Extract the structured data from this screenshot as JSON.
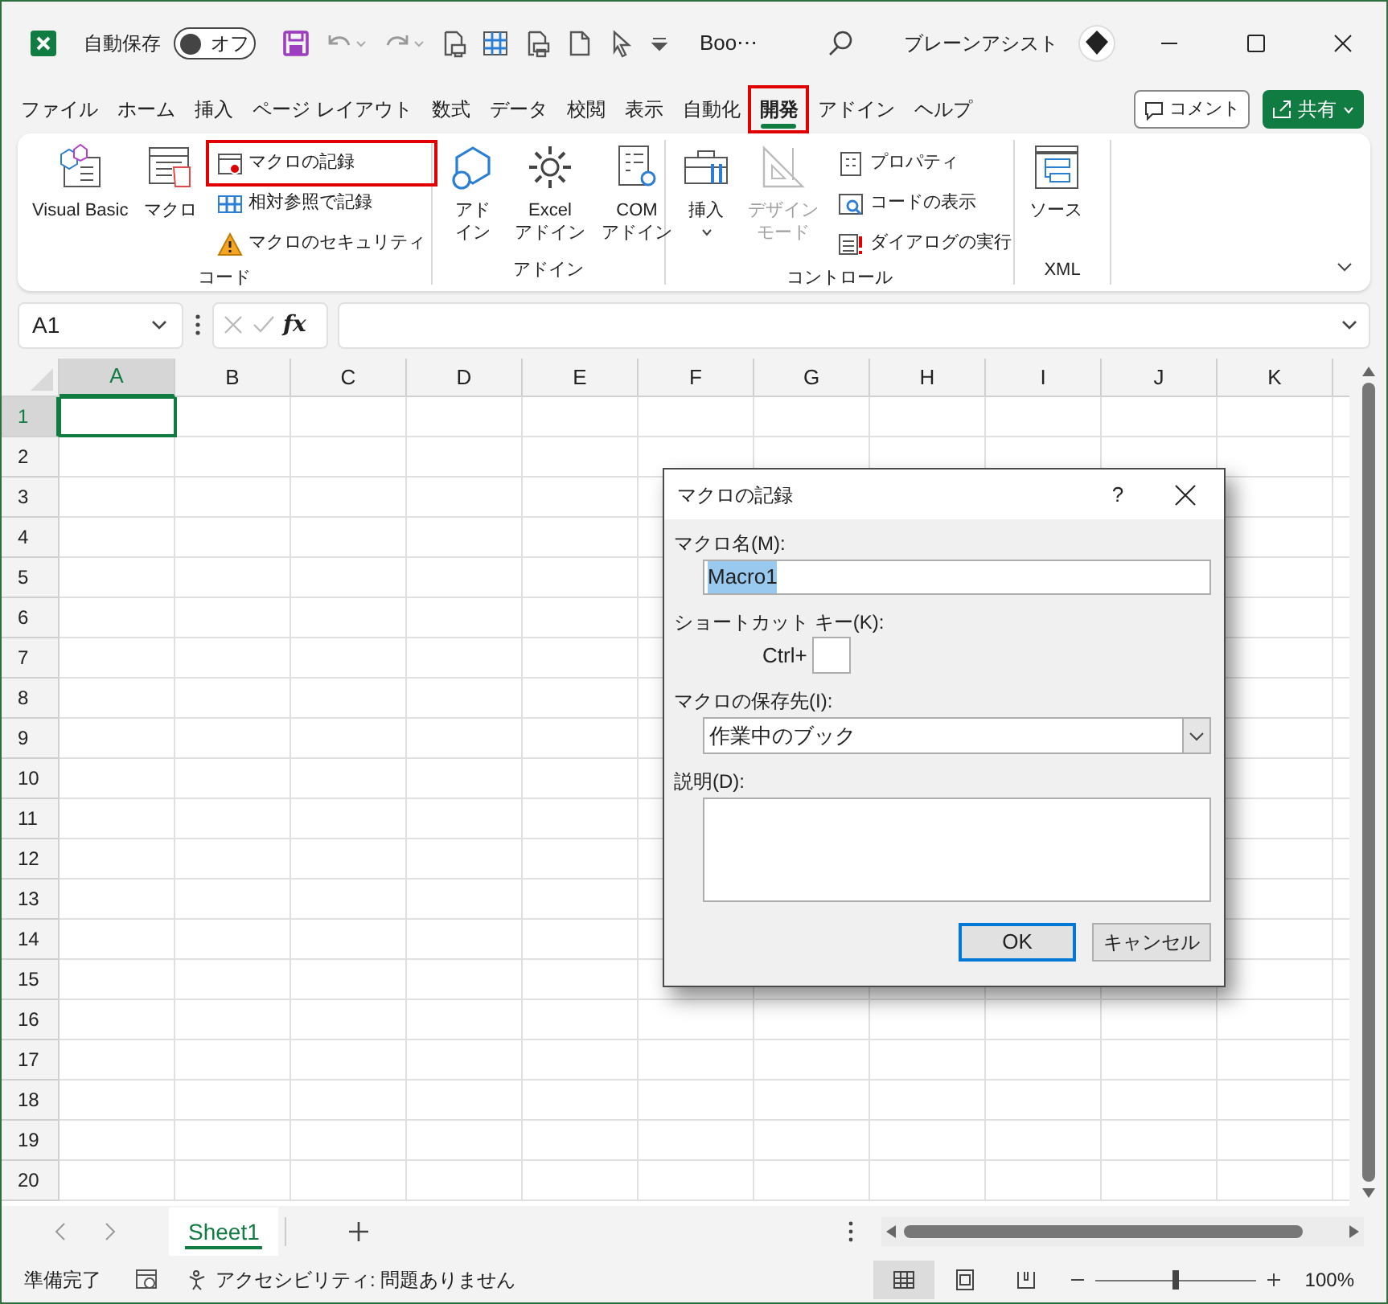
{
  "title_bar": {
    "autosave_label": "自動保存",
    "autosave": {
      "label": "オフ",
      "on": false
    },
    "file_name": "Boo⋯",
    "user_name": "ブレーンアシスト"
  },
  "ribbon_tabs": [
    {
      "label": "ファイル",
      "selected": false,
      "highlighted": false
    },
    {
      "label": "ホーム",
      "selected": false,
      "highlighted": false
    },
    {
      "label": "挿入",
      "selected": false,
      "highlighted": false
    },
    {
      "label": "ページ レイアウト",
      "selected": false,
      "highlighted": false
    },
    {
      "label": "数式",
      "selected": false,
      "highlighted": false
    },
    {
      "label": "データ",
      "selected": false,
      "highlighted": false
    },
    {
      "label": "校閲",
      "selected": false,
      "highlighted": false
    },
    {
      "label": "表示",
      "selected": false,
      "highlighted": false
    },
    {
      "label": "自動化",
      "selected": false,
      "highlighted": false
    },
    {
      "label": "開発",
      "selected": true,
      "highlighted": true
    },
    {
      "label": "アドイン",
      "selected": false,
      "highlighted": false
    },
    {
      "label": "ヘルプ",
      "selected": false,
      "highlighted": false
    }
  ],
  "comment_button": "コメント",
  "share_button": "共有",
  "ribbon_groups": [
    {
      "label": "コード",
      "items": [
        {
          "kind": "large",
          "lines": [
            "Visual Basic"
          ],
          "highlighted": false,
          "disabled": false
        },
        {
          "kind": "large",
          "lines": [
            "マクロ"
          ],
          "highlighted": false,
          "disabled": false
        },
        {
          "kind": "small",
          "label": "マクロの記録",
          "highlighted": true,
          "disabled": false
        },
        {
          "kind": "small",
          "label": "相対参照で記録",
          "highlighted": false,
          "disabled": false
        },
        {
          "kind": "small",
          "label": "マクロのセキュリティ",
          "highlighted": false,
          "disabled": false
        }
      ]
    },
    {
      "label": "アドイン",
      "items": [
        {
          "kind": "large",
          "lines": [
            "アド",
            "イン"
          ],
          "highlighted": false,
          "disabled": false
        },
        {
          "kind": "large",
          "lines": [
            "Excel",
            "アドイン"
          ],
          "highlighted": false,
          "disabled": false
        },
        {
          "kind": "large",
          "lines": [
            "COM",
            "アドイン"
          ],
          "highlighted": false,
          "disabled": false
        }
      ]
    },
    {
      "label": "コントロール",
      "items": [
        {
          "kind": "menu",
          "lines": [
            "挿入"
          ],
          "highlighted": false,
          "disabled": false
        },
        {
          "kind": "large",
          "lines": [
            "デザイン",
            "モード"
          ],
          "highlighted": false,
          "disabled": true
        },
        {
          "kind": "small",
          "label": "プロパティ",
          "highlighted": false,
          "disabled": false
        },
        {
          "kind": "small",
          "label": "コードの表示",
          "highlighted": false,
          "disabled": false
        },
        {
          "kind": "small",
          "label": "ダイアログの実行",
          "highlighted": false,
          "disabled": false
        }
      ]
    },
    {
      "label": "XML",
      "items": [
        {
          "kind": "large",
          "lines": [
            "ソース"
          ],
          "highlighted": false,
          "disabled": false
        }
      ]
    }
  ],
  "name_box": "A1",
  "function_label": "fx",
  "columns": [
    {
      "label": "A",
      "selected": true
    },
    {
      "label": "B",
      "selected": false
    },
    {
      "label": "C",
      "selected": false
    },
    {
      "label": "D",
      "selected": false
    },
    {
      "label": "E",
      "selected": false
    },
    {
      "label": "F",
      "selected": false
    },
    {
      "label": "G",
      "selected": false
    },
    {
      "label": "H",
      "selected": false
    },
    {
      "label": "I",
      "selected": false
    },
    {
      "label": "J",
      "selected": false
    },
    {
      "label": "K",
      "selected": false
    }
  ],
  "rows": [
    {
      "label": "1",
      "selected": true
    },
    {
      "label": "2",
      "selected": false
    },
    {
      "label": "3",
      "selected": false
    },
    {
      "label": "4",
      "selected": false
    },
    {
      "label": "5",
      "selected": false
    },
    {
      "label": "6",
      "selected": false
    },
    {
      "label": "7",
      "selected": false
    },
    {
      "label": "8",
      "selected": false
    },
    {
      "label": "9",
      "selected": false
    },
    {
      "label": "10",
      "selected": false
    },
    {
      "label": "11",
      "selected": false
    },
    {
      "label": "12",
      "selected": false
    },
    {
      "label": "13",
      "selected": false
    },
    {
      "label": "14",
      "selected": false
    },
    {
      "label": "15",
      "selected": false
    },
    {
      "label": "16",
      "selected": false
    },
    {
      "label": "17",
      "selected": false
    },
    {
      "label": "18",
      "selected": false
    },
    {
      "label": "19",
      "selected": false
    },
    {
      "label": "20",
      "selected": false
    }
  ],
  "dialog": {
    "title": "マクロの記録",
    "help": "?",
    "macro_name_label": "マクロ名(M):",
    "macro_name": "Macro1",
    "macro_name_selected": true,
    "shortcut_label": "ショートカット キー(K):",
    "ctrl_label": "Ctrl+",
    "store_label": "マクロの保存先(I):",
    "store_value": "作業中のブック",
    "description_label": "説明(D):",
    "ok_button": "OK",
    "cancel_button": "キャンセル"
  },
  "sheet_tabs": [
    {
      "label": "Sheet1",
      "selected": true
    }
  ],
  "status_bar": {
    "status": "準備完了",
    "accessibility": "アクセシビリティ: 問題ありません",
    "views": [
      {
        "selected": true
      },
      {
        "selected": false
      },
      {
        "selected": false
      }
    ],
    "zoom": {
      "level": 0.5,
      "label": "100%"
    }
  }
}
